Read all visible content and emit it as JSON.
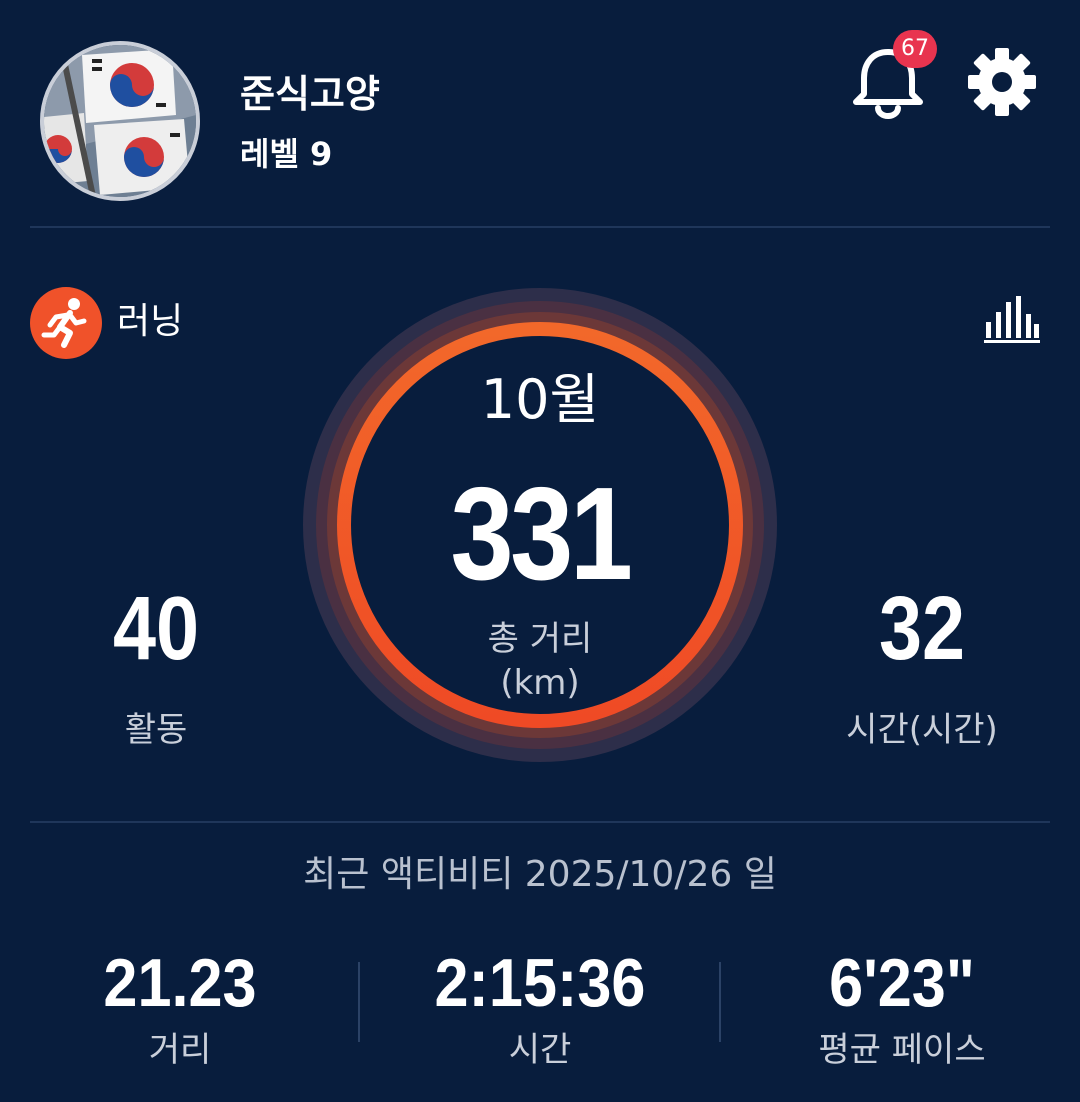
{
  "header": {
    "username": "준식고양",
    "level": "레벨 9",
    "notification_count": "67"
  },
  "activity": {
    "type_label": "러닝",
    "month": "10월",
    "total_distance": "331",
    "total_label": "총 거리",
    "total_unit": "(km)",
    "activities_value": "40",
    "activities_label": "활동",
    "hours_value": "32",
    "hours_label": "시간(시간)"
  },
  "recent": {
    "title": "최근 액티비티 2025/10/26 일",
    "stats": [
      {
        "value": "21.23",
        "label": "거리"
      },
      {
        "value": "2:15:36",
        "label": "시간"
      },
      {
        "value": "6'23\"",
        "label": "평균 페이스"
      }
    ]
  },
  "colors": {
    "background": "#081d3d",
    "accent_orange": "#f0522a",
    "badge_red": "#e8344f"
  },
  "icons": {
    "bell": "bell-icon",
    "settings": "gear-icon",
    "running": "running-person-icon",
    "chart": "bar-chart-icon"
  }
}
